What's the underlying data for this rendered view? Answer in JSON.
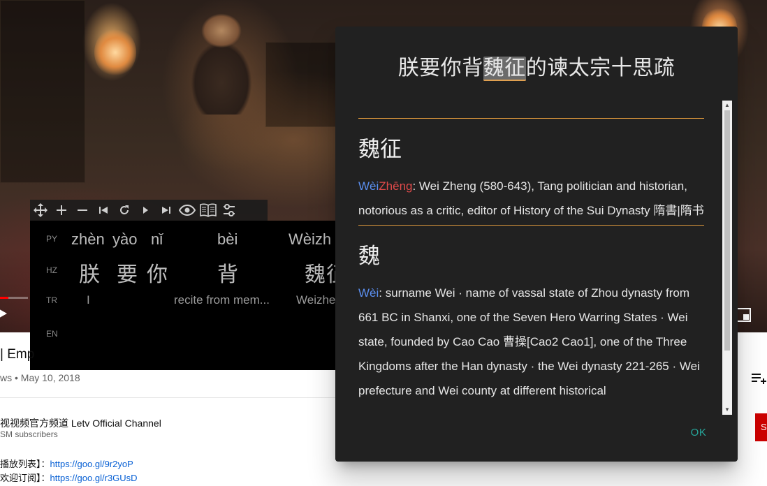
{
  "video": {
    "controls": {
      "play_icon": "play-icon",
      "miniplayer_icon": "miniplayer-icon"
    },
    "progress": 0.3
  },
  "toolbar": {
    "icons": [
      "move-icon",
      "plus-icon",
      "minus-icon",
      "skip-previous-icon",
      "replay-icon",
      "play-next-icon",
      "skip-next-icon",
      "eye-icon",
      "book-icon",
      "settings-sliders-icon"
    ]
  },
  "subtitles": {
    "labels": {
      "py": "PY",
      "hz": "HZ",
      "tr": "TR",
      "en": "EN"
    },
    "pinyin": [
      "zhèn",
      "yào",
      "nǐ",
      "bèi",
      "Wèizh"
    ],
    "hanzi": [
      "朕",
      "要",
      "你",
      "背",
      "魏征"
    ],
    "translation": [
      "I",
      "recite from mem...",
      "Weizhe"
    ]
  },
  "page": {
    "title_fragment": "| Emp",
    "meta": "ws • May 10, 2018",
    "channel": "视视频官方频道 Letv Official Channel",
    "subscribers": "SM subscribers",
    "desc": [
      {
        "label": "播放列表】：",
        "link": "https://goo.gl/9r2yoP"
      },
      {
        "label": "欢迎订阅】：",
        "link": "https://goo.gl/r3GUsD"
      }
    ],
    "subscribe_label": "S"
  },
  "dialog": {
    "sentence_before": "朕要你背",
    "sentence_highlight": "魏征",
    "sentence_after": "的谏太宗十思疏",
    "entries": [
      {
        "word": "魏征",
        "pinyin_1": "Wèi",
        "pinyin_2": "Zhēng",
        "definition": ": Wei Zheng (580-643), Tang politician and historian, notorious as a critic, editor of History of the Sui Dynasty 隋書|隋书"
      },
      {
        "word": "魏",
        "pinyin_1": "Wèi",
        "definition": ": surname Wei · name of vassal state of Zhou dynasty from 661 BC in Shanxi, one of the Seven Hero Warring States · Wei state, founded by Cao Cao 曹操[Cao2 Cao1], one of the Three Kingdoms after the Han dynasty · the Wei dynasty 221-265 · Wei prefecture and Wei county at different historical"
      }
    ],
    "ok_label": "OK",
    "scroll_up": "▲",
    "scroll_down": "▼"
  },
  "colors": {
    "accent_orange": "#e39b3d",
    "pinyin_tone4": "#5b8ff0",
    "pinyin_tone1": "#e04a4a",
    "ok_teal": "#26a69a"
  }
}
